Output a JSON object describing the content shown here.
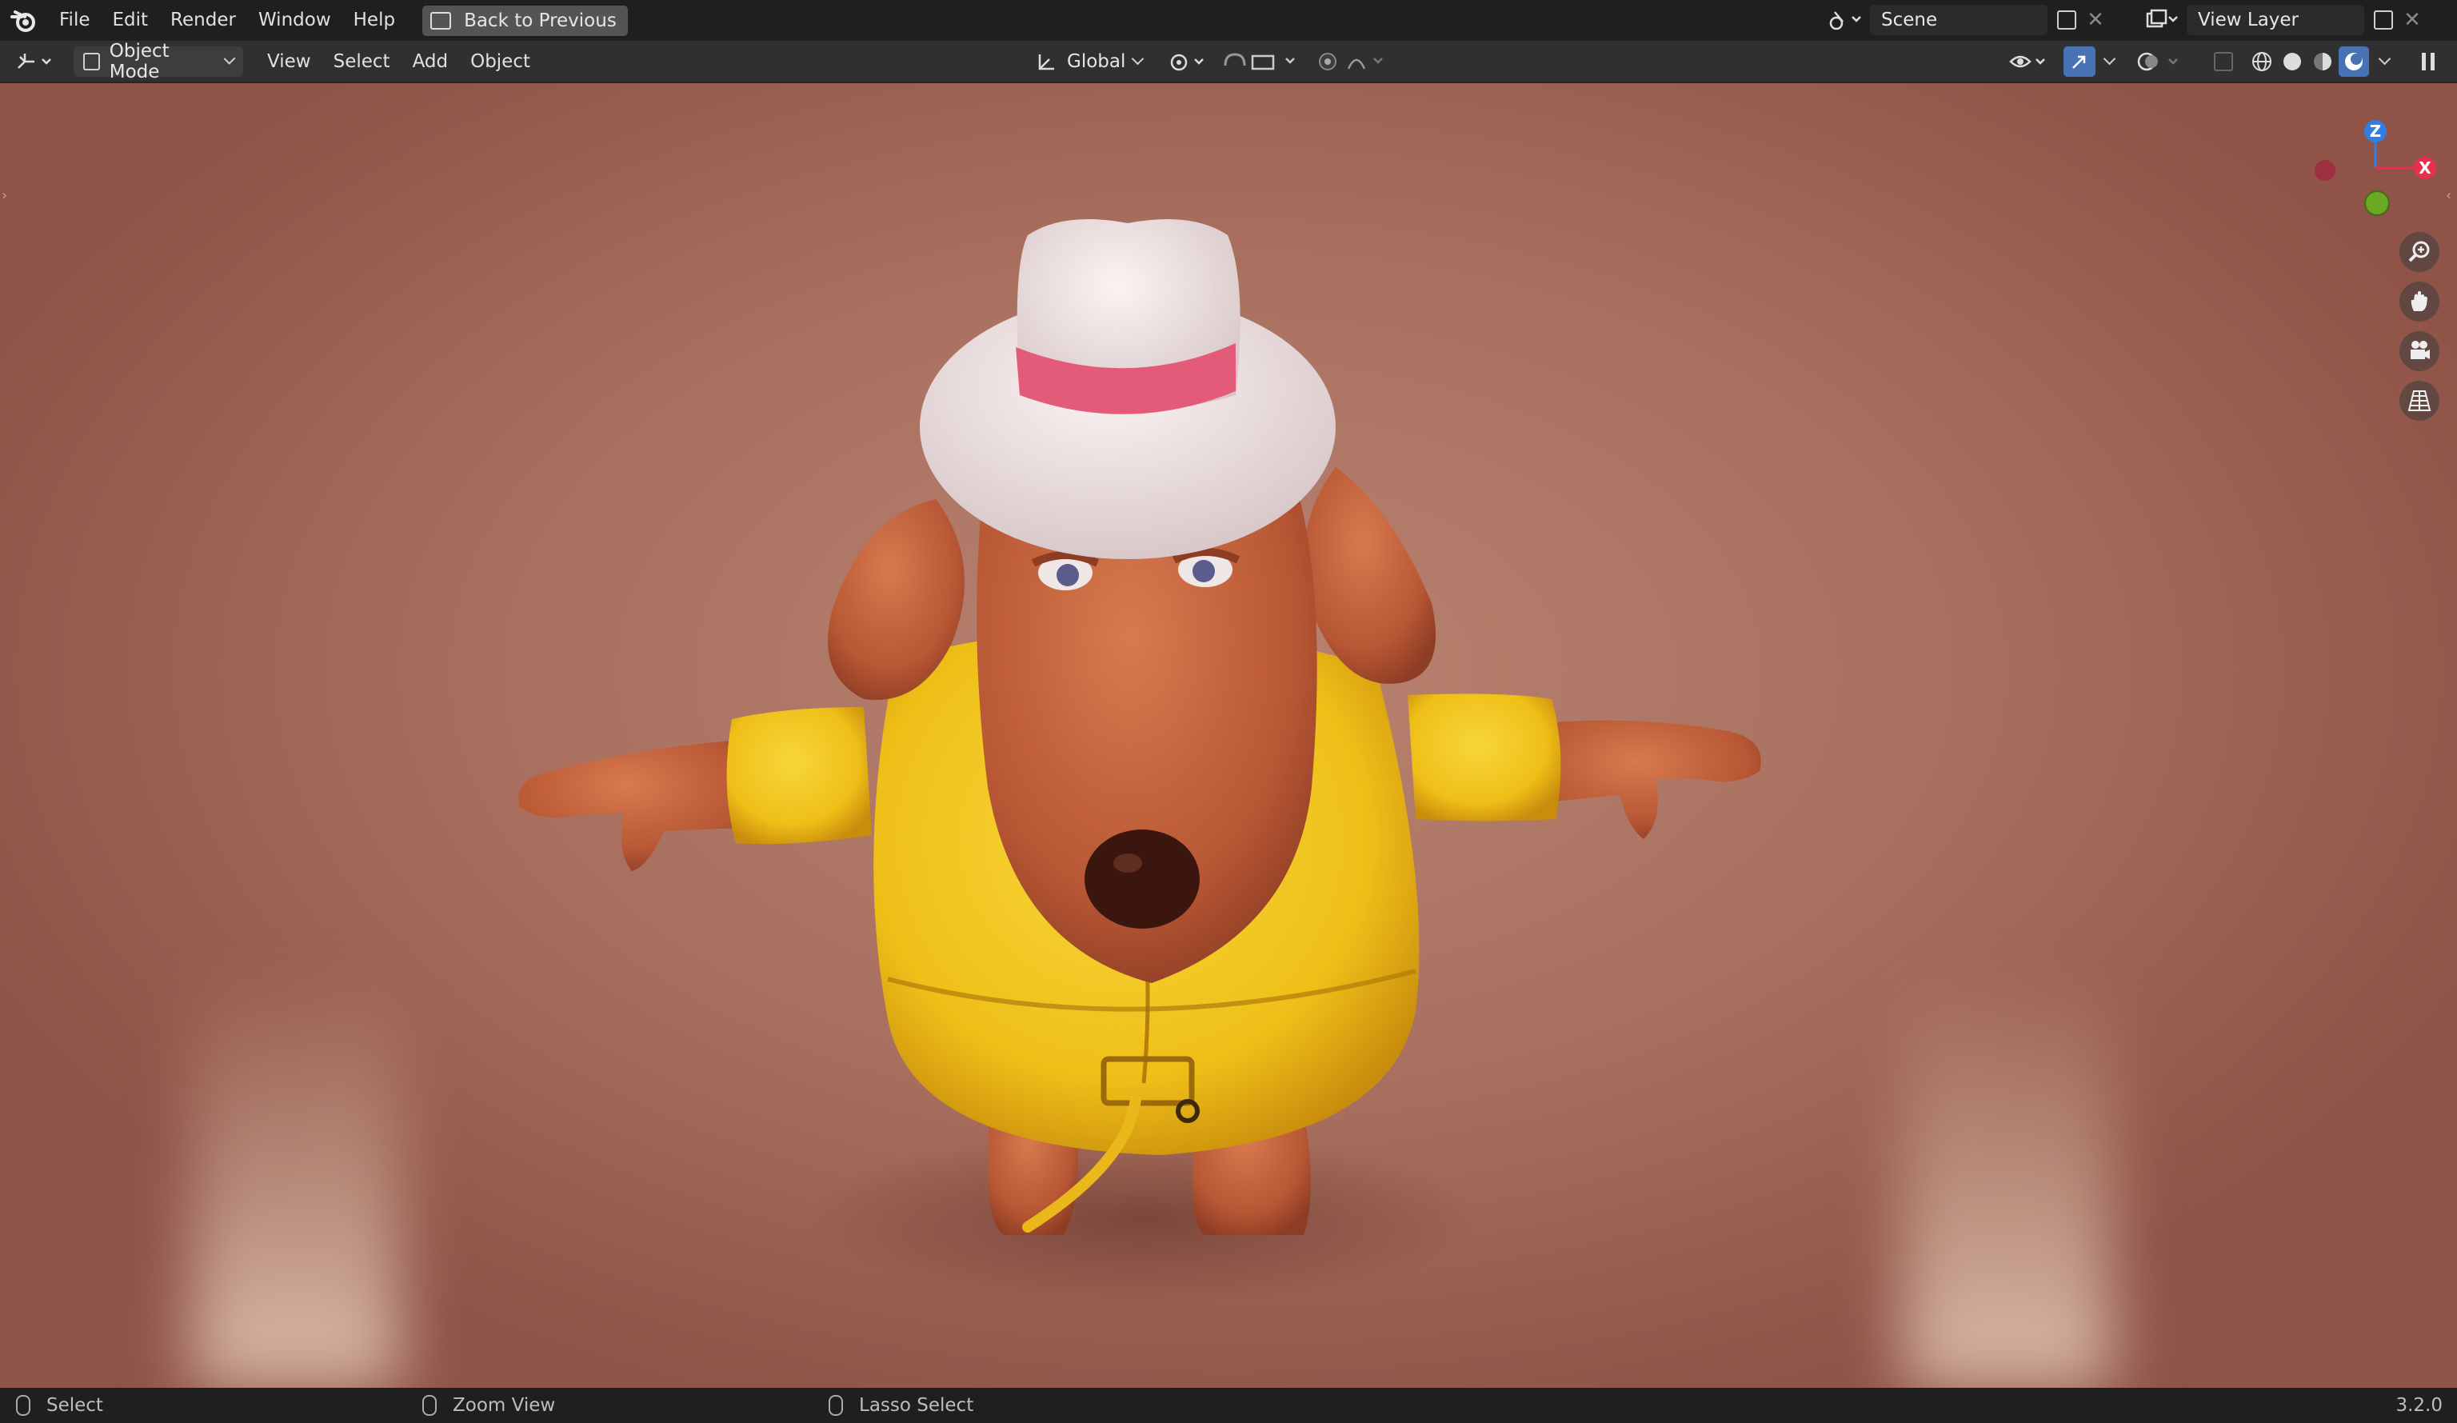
{
  "menubar": {
    "items": [
      "File",
      "Edit",
      "Render",
      "Window",
      "Help"
    ],
    "back_button": "Back to Previous",
    "scene_field": "Scene",
    "view_layer_field": "View Layer"
  },
  "header": {
    "mode": "Object Mode",
    "menus": [
      "View",
      "Select",
      "Add",
      "Object"
    ],
    "transform_orientation": "Global"
  },
  "gizmo": {
    "z": "Z",
    "x": "X",
    "colors": {
      "z": "#2f7fe6",
      "x": "#e8304e",
      "y": "#6aa822",
      "neg_x": "#9e2f3f"
    }
  },
  "statusbar": {
    "select": "Select",
    "zoom": "Zoom View",
    "lasso": "Lasso Select",
    "version": "3.2.0"
  },
  "colors": {
    "accent": "#4772b3",
    "viewport_bg": "#a86f5e",
    "raincoat": "#f2c419",
    "dog_skin": "#c2603a",
    "hat": "#ece1e1",
    "hat_band": "#e45a79"
  }
}
